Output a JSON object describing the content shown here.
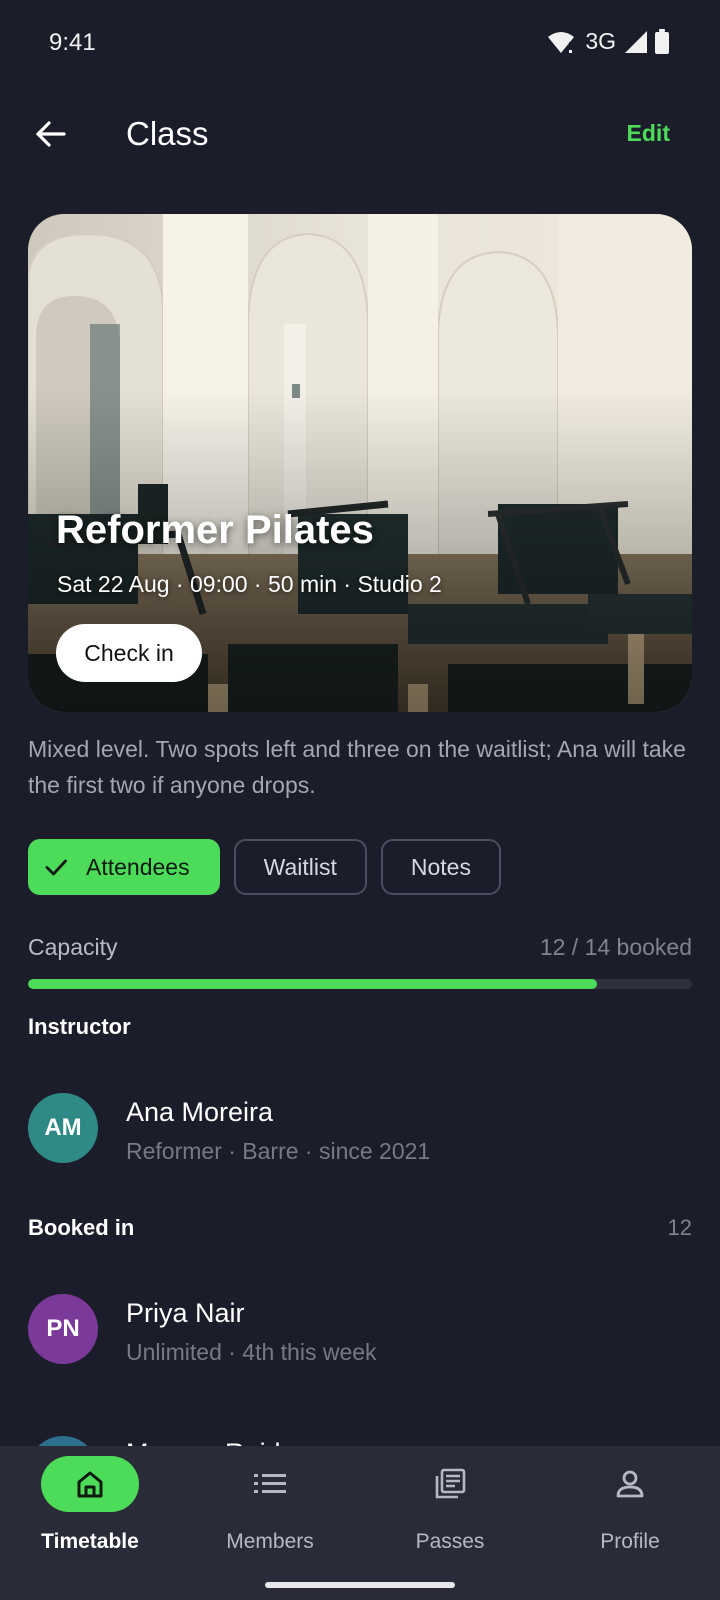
{
  "status_bar": {
    "time": "9:41",
    "network": "3G"
  },
  "app_bar": {
    "title": "Class",
    "edit_label": "Edit"
  },
  "hero": {
    "class_name": "Reformer Pilates",
    "meta": "Sat 22 Aug · 09:00 · 50 min · Studio 2",
    "checkin_label": "Check in"
  },
  "description": "Mixed level. Two spots left and three on the waitlist; Ana will take the first two if anyone drops.",
  "tabs": [
    {
      "label": "Attendees",
      "selected": true
    },
    {
      "label": "Waitlist",
      "selected": false
    },
    {
      "label": "Notes",
      "selected": false
    }
  ],
  "capacity": {
    "label": "Capacity",
    "value_text": "12 / 14 booked",
    "booked": 12,
    "total": 14
  },
  "instructor": {
    "header": "Instructor",
    "initials": "AM",
    "name": "Ana Moreira",
    "subtitle": "Reformer · Barre · since 2021",
    "avatar_color": "#2f8a86"
  },
  "booked": {
    "header": "Booked in",
    "count": "12",
    "items": [
      {
        "initials": "PN",
        "name": "Priya Nair",
        "subtitle": "Unlimited · 4th this week",
        "avatar_color": "#7b3a9a"
      },
      {
        "initials": "",
        "name": "Morgan Reid",
        "subtitle": "",
        "avatar_color": "#2e6f8c"
      }
    ]
  },
  "bottom_nav": [
    {
      "label": "Timetable",
      "icon": "home-icon",
      "active": true
    },
    {
      "label": "Members",
      "icon": "list-icon",
      "active": false
    },
    {
      "label": "Passes",
      "icon": "passes-icon",
      "active": false
    },
    {
      "label": "Profile",
      "icon": "person-icon",
      "active": false
    }
  ],
  "colors": {
    "accent": "#4ddc5a",
    "background": "#1c1d2a",
    "nav_background": "#292b39"
  }
}
